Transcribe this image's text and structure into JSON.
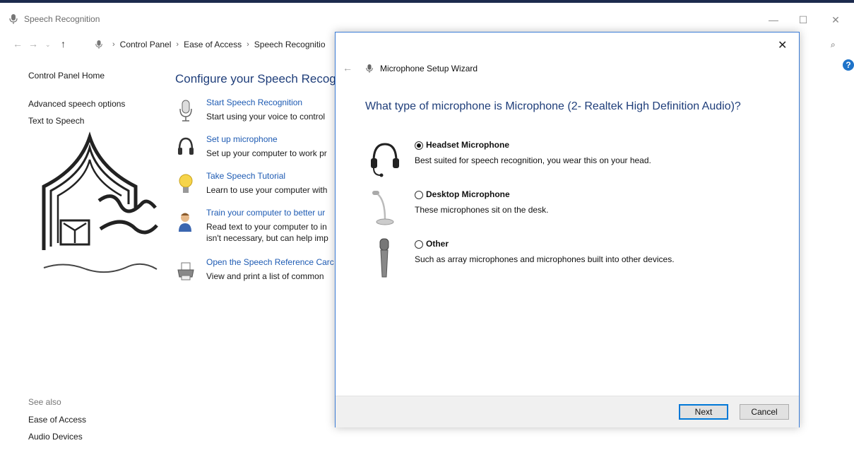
{
  "window": {
    "title": "Speech Recognition",
    "controls": {
      "minimize": "—",
      "maximize": "☐",
      "close": "✕"
    }
  },
  "address_bar": {
    "crumbs": [
      "Control Panel",
      "Ease of Access",
      "Speech Recognitio"
    ],
    "separator": "›"
  },
  "left_nav": {
    "home": "Control Panel Home",
    "advanced": "Advanced speech options",
    "tts": "Text to Speech",
    "see_also": "See also",
    "ease_of_access": "Ease of Access",
    "audio_devices": "Audio Devices"
  },
  "main": {
    "title": "Configure your Speech Recogn",
    "tasks": [
      {
        "icon": "microphone-icon",
        "link": "Start Speech Recognition",
        "desc": "Start using your voice to control"
      },
      {
        "icon": "headset-icon",
        "link": "Set up microphone",
        "desc": "Set up your computer to work pr"
      },
      {
        "icon": "lightbulb-icon",
        "link": "Take Speech Tutorial",
        "desc": "Learn to use your computer with"
      },
      {
        "icon": "user-train-icon",
        "link": "Train your computer to better ur",
        "desc": "Read text to your computer to in",
        "desc2": "isn't necessary, but can help imp"
      },
      {
        "icon": "printer-icon",
        "link": "Open the Speech Reference Carc",
        "desc": "View and print a list of common"
      }
    ]
  },
  "wizard": {
    "title": "Microphone Setup Wizard",
    "question": "What type of microphone is Microphone (2- Realtek High Definition Audio)?",
    "options": [
      {
        "label": "Headset Microphone",
        "desc": "Best suited for speech recognition, you wear this on your head.",
        "selected": true,
        "icon": "headset-icon"
      },
      {
        "label": "Desktop Microphone",
        "desc": "These microphones sit on the desk.",
        "selected": false,
        "icon": "desktop-microphone-icon"
      },
      {
        "label": "Other",
        "desc": "Such as array microphones and microphones built into other devices.",
        "selected": false,
        "icon": "handheld-microphone-icon"
      }
    ],
    "buttons": {
      "next": "Next",
      "cancel": "Cancel"
    },
    "close": "✕",
    "back": "←"
  },
  "colors": {
    "accent": "#0078d7",
    "link": "#1e5bb3",
    "heading": "#1f3e7a",
    "titlebar_border": "#1c2a4d"
  }
}
